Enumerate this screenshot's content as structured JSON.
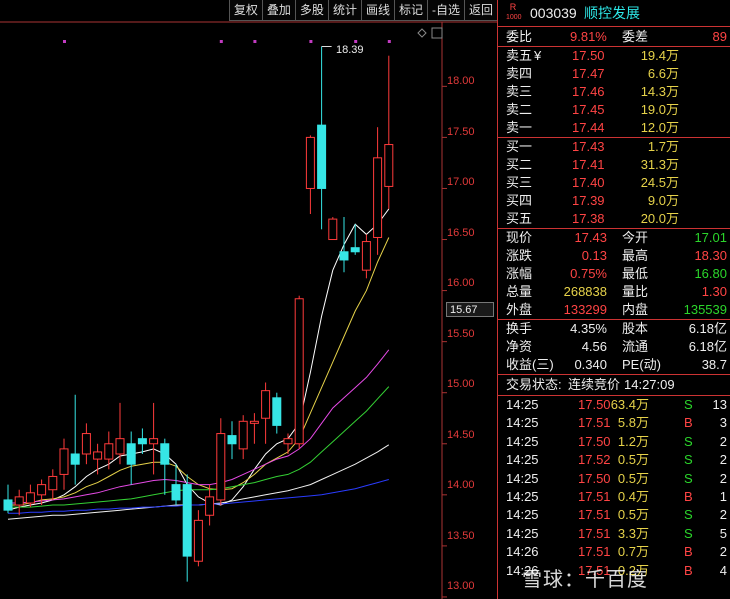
{
  "toolbar": [
    "复权",
    "叠加",
    "多股",
    "统计",
    "画线",
    "标记",
    "-自选",
    "返回"
  ],
  "chart": {
    "y_labels": [
      "18.00",
      "17.50",
      "17.00",
      "16.50",
      "16.00",
      "15.50",
      "15.00",
      "14.50",
      "14.00",
      "13.50",
      "13.00"
    ],
    "marker_value": "15.67",
    "high_label": "18.39"
  },
  "chart_data": {
    "type": "candlestick",
    "ylim": [
      12.98,
      18.63
    ],
    "candles": [
      {
        "o": 13.95,
        "h": 14.1,
        "l": 13.82,
        "c": 13.85
      },
      {
        "o": 13.9,
        "h": 14.05,
        "l": 13.8,
        "c": 13.98
      },
      {
        "o": 13.92,
        "h": 14.1,
        "l": 13.88,
        "c": 14.02
      },
      {
        "o": 14.0,
        "h": 14.15,
        "l": 13.9,
        "c": 14.1
      },
      {
        "o": 14.05,
        "h": 14.25,
        "l": 13.95,
        "c": 14.18
      },
      {
        "o": 14.2,
        "h": 14.55,
        "l": 14.05,
        "c": 14.45
      },
      {
        "o": 14.4,
        "h": 14.98,
        "l": 14.1,
        "c": 14.3
      },
      {
        "o": 14.4,
        "h": 14.7,
        "l": 14.3,
        "c": 14.6
      },
      {
        "o": 14.35,
        "h": 14.5,
        "l": 14.2,
        "c": 14.42
      },
      {
        "o": 14.35,
        "h": 14.62,
        "l": 14.25,
        "c": 14.5
      },
      {
        "o": 14.4,
        "h": 14.9,
        "l": 14.3,
        "c": 14.55
      },
      {
        "o": 14.5,
        "h": 14.62,
        "l": 14.1,
        "c": 14.3
      },
      {
        "o": 14.55,
        "h": 14.65,
        "l": 14.4,
        "c": 14.5
      },
      {
        "o": 14.5,
        "h": 14.9,
        "l": 14.2,
        "c": 14.55
      },
      {
        "o": 14.5,
        "h": 14.55,
        "l": 14.0,
        "c": 14.3
      },
      {
        "o": 14.1,
        "h": 14.3,
        "l": 13.9,
        "c": 13.95
      },
      {
        "o": 14.1,
        "h": 14.2,
        "l": 13.15,
        "c": 13.4
      },
      {
        "o": 13.35,
        "h": 13.85,
        "l": 13.3,
        "c": 13.75
      },
      {
        "o": 13.8,
        "h": 14.1,
        "l": 13.7,
        "c": 13.98
      },
      {
        "o": 13.95,
        "h": 14.75,
        "l": 13.9,
        "c": 14.6
      },
      {
        "o": 14.58,
        "h": 14.72,
        "l": 14.35,
        "c": 14.5
      },
      {
        "o": 14.45,
        "h": 14.78,
        "l": 14.35,
        "c": 14.72
      },
      {
        "o": 14.7,
        "h": 14.8,
        "l": 14.5,
        "c": 14.72
      },
      {
        "o": 14.75,
        "h": 15.1,
        "l": 14.5,
        "c": 15.02
      },
      {
        "o": 14.95,
        "h": 15.0,
        "l": 14.6,
        "c": 14.68
      },
      {
        "o": 14.5,
        "h": 14.6,
        "l": 14.4,
        "c": 14.55
      },
      {
        "o": 14.5,
        "h": 15.95,
        "l": 14.45,
        "c": 15.92
      },
      {
        "o": 17.0,
        "h": 17.52,
        "l": 16.75,
        "c": 17.5
      },
      {
        "o": 17.62,
        "h": 18.39,
        "l": 16.6,
        "c": 17.0
      },
      {
        "o": 16.5,
        "h": 16.72,
        "l": 16.5,
        "c": 16.7
      },
      {
        "o": 16.38,
        "h": 16.72,
        "l": 16.18,
        "c": 16.3
      },
      {
        "o": 16.42,
        "h": 16.65,
        "l": 16.35,
        "c": 16.38
      },
      {
        "o": 16.2,
        "h": 16.55,
        "l": 16.12,
        "c": 16.48
      },
      {
        "o": 16.52,
        "h": 17.6,
        "l": 16.35,
        "c": 17.3
      },
      {
        "o": 17.02,
        "h": 18.3,
        "l": 16.8,
        "c": 17.43
      }
    ],
    "ma": [
      {
        "color": "#ffffff",
        "values": [
          13.85,
          13.88,
          13.9,
          13.92,
          13.95,
          14.0,
          14.08,
          14.18,
          14.25,
          14.3,
          14.38,
          14.4,
          14.42,
          14.45,
          14.4,
          14.3,
          14.1,
          13.98,
          13.92,
          13.9,
          13.95,
          14.08,
          14.25,
          14.4,
          14.5,
          14.55,
          14.7,
          15.2,
          15.75,
          16.2,
          16.45,
          16.65,
          16.55,
          16.65,
          16.8
        ]
      },
      {
        "color": "#e6d24a",
        "values": [
          13.9,
          13.9,
          13.92,
          13.95,
          13.96,
          13.98,
          14.02,
          14.08,
          14.12,
          14.18,
          14.24,
          14.28,
          14.3,
          14.32,
          14.32,
          14.28,
          14.18,
          14.1,
          14.06,
          14.05,
          14.06,
          14.12,
          14.2,
          14.3,
          14.36,
          14.42,
          14.55,
          14.8,
          15.05,
          15.3,
          15.55,
          15.8,
          16.0,
          16.28,
          16.52
        ]
      },
      {
        "color": "#e64ae6",
        "values": [
          13.92,
          13.92,
          13.93,
          13.94,
          13.95,
          13.96,
          13.98,
          14.0,
          14.02,
          14.05,
          14.08,
          14.1,
          14.12,
          14.14,
          14.15,
          14.14,
          14.12,
          14.1,
          14.1,
          14.12,
          14.15,
          14.2,
          14.25,
          14.3,
          14.35,
          14.38,
          14.45,
          14.55,
          14.7,
          14.85,
          14.95,
          15.05,
          15.15,
          15.28,
          15.42
        ]
      },
      {
        "color": "#34d034",
        "values": [
          13.88,
          13.88,
          13.88,
          13.89,
          13.9,
          13.9,
          13.91,
          13.92,
          13.93,
          13.94,
          13.95,
          13.96,
          13.98,
          14.0,
          14.02,
          14.04,
          14.05,
          14.05,
          14.05,
          14.06,
          14.08,
          14.1,
          14.12,
          14.15,
          14.18,
          14.2,
          14.25,
          14.32,
          14.42,
          14.52,
          14.62,
          14.72,
          14.82,
          14.94,
          15.06
        ]
      },
      {
        "color": "#f0f0f0",
        "values": [
          13.76,
          13.77,
          13.78,
          13.79,
          13.8,
          13.8,
          13.81,
          13.82,
          13.83,
          13.84,
          13.85,
          13.86,
          13.87,
          13.88,
          13.89,
          13.9,
          13.9,
          13.9,
          13.91,
          13.92,
          13.94,
          13.96,
          13.98,
          14.0,
          14.02,
          14.04,
          14.07,
          14.1,
          14.15,
          14.2,
          14.25,
          14.3,
          14.36,
          14.42,
          14.49
        ]
      },
      {
        "color": "#2a3cff",
        "values": [
          13.82,
          13.82,
          13.83,
          13.83,
          13.84,
          13.84,
          13.85,
          13.85,
          13.86,
          13.86,
          13.87,
          13.87,
          13.88,
          13.88,
          13.89,
          13.89,
          13.9,
          13.9,
          13.91,
          13.91,
          13.92,
          13.93,
          13.94,
          13.95,
          13.96,
          13.97,
          13.98,
          13.99,
          14.0,
          14.02,
          14.04,
          14.06,
          14.09,
          14.12,
          14.15
        ]
      }
    ]
  },
  "quote": {
    "badge_top": "R",
    "badge_bottom": "1000",
    "code": "003039",
    "name": "顺控发展",
    "weibi_label": "委比",
    "weibi_value": "9.81%",
    "weicha_label": "委差",
    "weicha_value": "89",
    "asks": [
      {
        "label": "卖五",
        "price": "17.50",
        "vol": "19.4万",
        "extra": "¥"
      },
      {
        "label": "卖四",
        "price": "17.47",
        "vol": "6.6万"
      },
      {
        "label": "卖三",
        "price": "17.46",
        "vol": "14.3万"
      },
      {
        "label": "卖二",
        "price": "17.45",
        "vol": "19.0万"
      },
      {
        "label": "卖一",
        "price": "17.44",
        "vol": "12.0万"
      }
    ],
    "bids": [
      {
        "label": "买一",
        "price": "17.43",
        "vol": "1.7万"
      },
      {
        "label": "买二",
        "price": "17.41",
        "vol": "31.3万"
      },
      {
        "label": "买三",
        "price": "17.40",
        "vol": "24.5万"
      },
      {
        "label": "买四",
        "price": "17.39",
        "vol": "9.0万"
      },
      {
        "label": "买五",
        "price": "17.38",
        "vol": "20.0万"
      }
    ],
    "stats": [
      {
        "l1": "现价",
        "v1": "17.43",
        "c1": "red",
        "l2": "今开",
        "v2": "17.01",
        "c2": "green"
      },
      {
        "l1": "涨跌",
        "v1": "0.13",
        "c1": "red",
        "l2": "最高",
        "v2": "18.30",
        "c2": "red"
      },
      {
        "l1": "涨幅",
        "v1": "0.75%",
        "c1": "red",
        "l2": "最低",
        "v2": "16.80",
        "c2": "green"
      },
      {
        "l1": "总量",
        "v1": "268838",
        "c1": "yellow",
        "l2": "量比",
        "v2": "1.30",
        "c2": "red"
      },
      {
        "l1": "外盘",
        "v1": "133299",
        "c1": "red",
        "l2": "内盘",
        "v2": "135539",
        "c2": "green"
      }
    ],
    "finance": [
      {
        "l1": "换手",
        "v1": "4.35%",
        "l2": "股本",
        "v2": "6.18亿"
      },
      {
        "l1": "净资",
        "v1": "4.56",
        "l2": "流通",
        "v2": "6.18亿"
      },
      {
        "l1": "收益(三)",
        "v1": "0.340",
        "l2": "PE(动)",
        "v2": "38.7"
      }
    ],
    "status_label": "交易状态:",
    "status_value": "连续竞价",
    "status_time": "14:27:09",
    "ticks": [
      {
        "t": "14:25",
        "p": "17.50",
        "v": "63.4万",
        "d": "S",
        "n": "13"
      },
      {
        "t": "14:25",
        "p": "17.51",
        "v": "5.8万",
        "d": "B",
        "n": "3"
      },
      {
        "t": "14:25",
        "p": "17.50",
        "v": "1.2万",
        "d": "S",
        "n": "2"
      },
      {
        "t": "14:25",
        "p": "17.52",
        "v": "0.5万",
        "d": "S",
        "n": "2"
      },
      {
        "t": "14:25",
        "p": "17.50",
        "v": "0.5万",
        "d": "S",
        "n": "2"
      },
      {
        "t": "14:25",
        "p": "17.51",
        "v": "0.4万",
        "d": "B",
        "n": "1"
      },
      {
        "t": "14:25",
        "p": "17.51",
        "v": "0.5万",
        "d": "S",
        "n": "2"
      },
      {
        "t": "14:25",
        "p": "17.51",
        "v": "3.3万",
        "d": "S",
        "n": "5"
      },
      {
        "t": "14:26",
        "p": "17.51",
        "v": "0.7万",
        "d": "B",
        "n": "2"
      },
      {
        "t": "14:26",
        "p": "17.51",
        "v": "0.2万",
        "d": "B",
        "n": "4"
      }
    ]
  },
  "watermark": "雪球：千百度"
}
